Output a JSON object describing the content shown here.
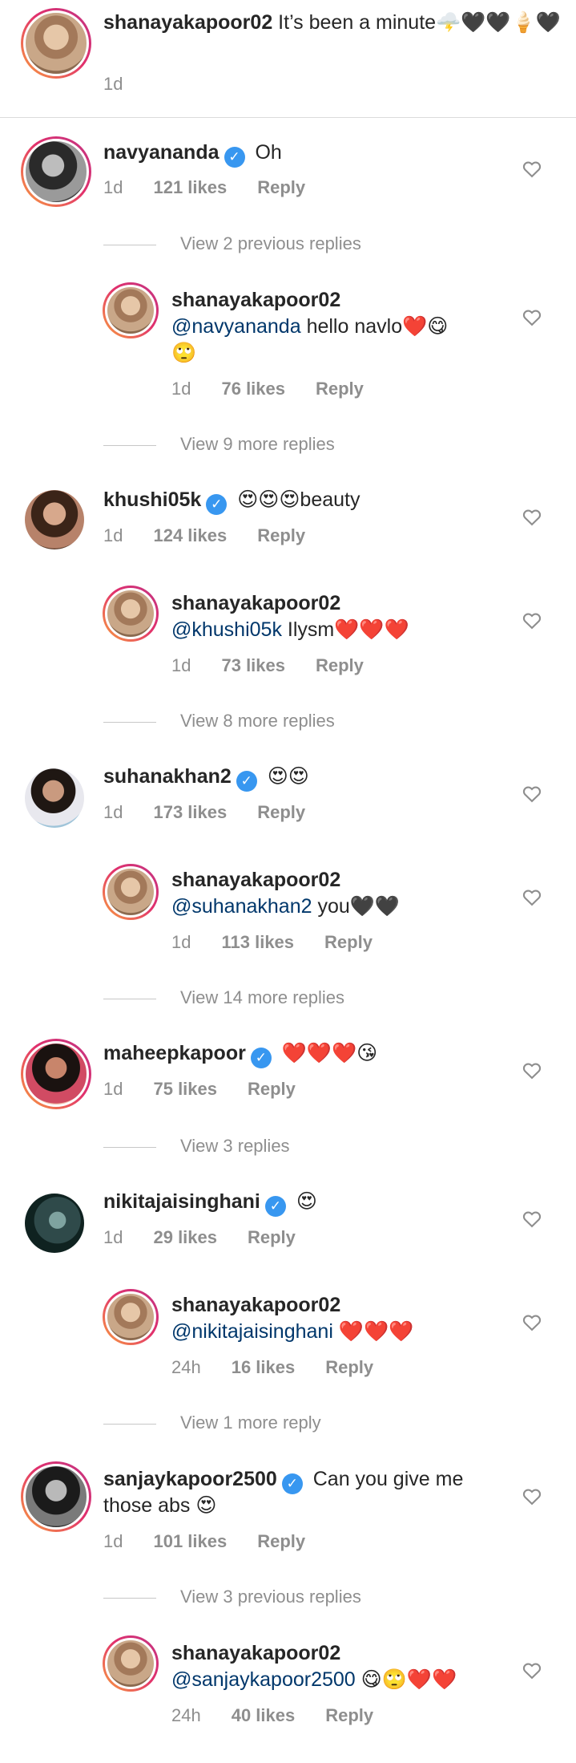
{
  "caption": {
    "username": "shanayakapoor02",
    "text": "It’s been a minute🌩️🖤🖤🍦🖤",
    "time": "1d"
  },
  "comments": [
    {
      "username": "navyananda",
      "verified": true,
      "text": "Oh",
      "time": "1d",
      "likes": "121 likes",
      "reply": "Reply",
      "view_replies": "View 2 previous replies",
      "replies": [
        {
          "username": "shanayakapoor02",
          "mention": "@navyananda",
          "text": "hello navlo❤️😋",
          "text2": "🙄",
          "time": "1d",
          "likes": "76 likes",
          "reply": "Reply"
        }
      ],
      "after_replies": "View 9 more replies"
    },
    {
      "username": "khushi05k",
      "verified": true,
      "text": "😍😍😍beauty",
      "time": "1d",
      "likes": "124 likes",
      "reply": "Reply",
      "replies": [
        {
          "username": "shanayakapoor02",
          "mention": "@khushi05k",
          "text": "Ilysm❤️❤️❤️",
          "time": "1d",
          "likes": "73 likes",
          "reply": "Reply"
        }
      ],
      "after_replies": "View 8 more replies"
    },
    {
      "username": "suhanakhan2",
      "verified": true,
      "text": "😍😍",
      "time": "1d",
      "likes": "173 likes",
      "reply": "Reply",
      "replies": [
        {
          "username": "shanayakapoor02",
          "mention": "@suhanakhan2",
          "text": "you🖤🖤",
          "time": "1d",
          "likes": "113 likes",
          "reply": "Reply"
        }
      ],
      "after_replies": "View 14 more replies"
    },
    {
      "username": "maheepkapoor",
      "verified": true,
      "text": "❤️❤️❤️😘",
      "time": "1d",
      "likes": "75 likes",
      "reply": "Reply",
      "after_replies": "View 3 replies"
    },
    {
      "username": "nikitajaisinghani",
      "verified": true,
      "text": "😍",
      "time": "1d",
      "likes": "29 likes",
      "reply": "Reply",
      "replies": [
        {
          "username": "shanayakapoor02",
          "mention": "@nikitajaisinghani",
          "text": "❤️❤️❤️",
          "time": "24h",
          "likes": "16 likes",
          "reply": "Reply"
        }
      ],
      "after_replies": "View 1 more reply"
    },
    {
      "username": "sanjaykapoor2500",
      "verified": true,
      "text": "Can you give me",
      "text2": "those abs 😍",
      "time": "1d",
      "likes": "101 likes",
      "reply": "Reply",
      "view_replies": "View 3 previous replies",
      "replies": [
        {
          "username": "shanayakapoor02",
          "mention": "@sanjaykapoor2500",
          "text": "😋🙄❤️❤️",
          "time": "24h",
          "likes": "40 likes",
          "reply": "Reply"
        }
      ]
    }
  ],
  "icons": {
    "verified": "verified-badge-icon",
    "like": "heart-outline-icon"
  },
  "colors": {
    "verified": "#3897f0",
    "mention": "#00376b",
    "meta": "#8e8e8e"
  }
}
